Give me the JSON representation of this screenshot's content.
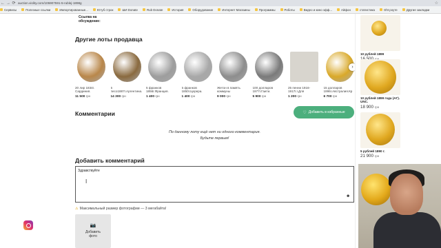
{
  "browser": {
    "url": "auction.violity.com/105907591-5-rublej-1898g",
    "bookmarks": [
      "Сервисы",
      "Полезные ссылки",
      "Импортированные...",
      "Ютуб строк",
      "ШИ Donate",
      "Rub Donate",
      "История",
      "Оборудование",
      "Интернет Магазины",
      "Программы",
      "Роботы",
      "Видео и кино эфф...",
      "Айфон",
      "статистика",
      "Ght роуте",
      "Другие закладки"
    ]
  },
  "discussion_label": "Ссылка на обсуждение:",
  "other_lots": {
    "heading": "Другие лоты продавца",
    "items": [
      {
        "name": "20 лир 1834г. Сардиния.",
        "price": "11 500",
        "currency": "грн",
        "color": "#b9874a"
      },
      {
        "name": "5 песо1887г.Аргентина.",
        "price": "14 300",
        "currency": "грн",
        "color": "#8a6a3f"
      },
      {
        "name": "5 франков 1856г.Франция.",
        "price": "1 400",
        "currency": "грн",
        "color": "#9d9d9d"
      },
      {
        "name": "5 франков 1850г.Церера.",
        "price": "1 400",
        "currency": "грн",
        "color": "#a8a8a8"
      },
      {
        "name": "Жетон в память коммуны",
        "price": "9 000",
        "currency": "грн",
        "color": "#8d8d8d"
      },
      {
        "name": "100 долларов 1977г.Гаити.",
        "price": "5 900",
        "currency": "грн",
        "color": "#7a7a7a"
      },
      {
        "name": "25 пенни 1916-1917г.г.Для",
        "price": "1 200",
        "currency": "грн",
        "color": "#c9c6bf"
      },
      {
        "name": "15 долларов 1996г.Австралия.Кр",
        "price": "6 700",
        "currency": "грн",
        "color": "#d9a92a"
      }
    ]
  },
  "comments": {
    "heading": "Комментарии",
    "fav_button": "Добавить в избранные",
    "empty_line1": "По данному лоту ещё нет ни одного комментария.",
    "empty_line2": "Будьте первым!"
  },
  "add_comment": {
    "heading": "Добавить комментарий",
    "value": "Здравствуйте",
    "max_size": "Максимальный размер фотографии — 3 мегабайта!",
    "add_photo_line1": "Добавить",
    "add_photo_line2": "фото"
  },
  "sidebar": [
    {
      "title": "10 рублей 1899",
      "price": "16 500",
      "currency": "грн"
    },
    {
      "title": "10 рублей 1899 года (АГ). UNC.",
      "price": "18 900",
      "currency": "грн"
    },
    {
      "title": "5 рублей 1890 г.",
      "price": "21 900",
      "currency": "грн"
    }
  ]
}
